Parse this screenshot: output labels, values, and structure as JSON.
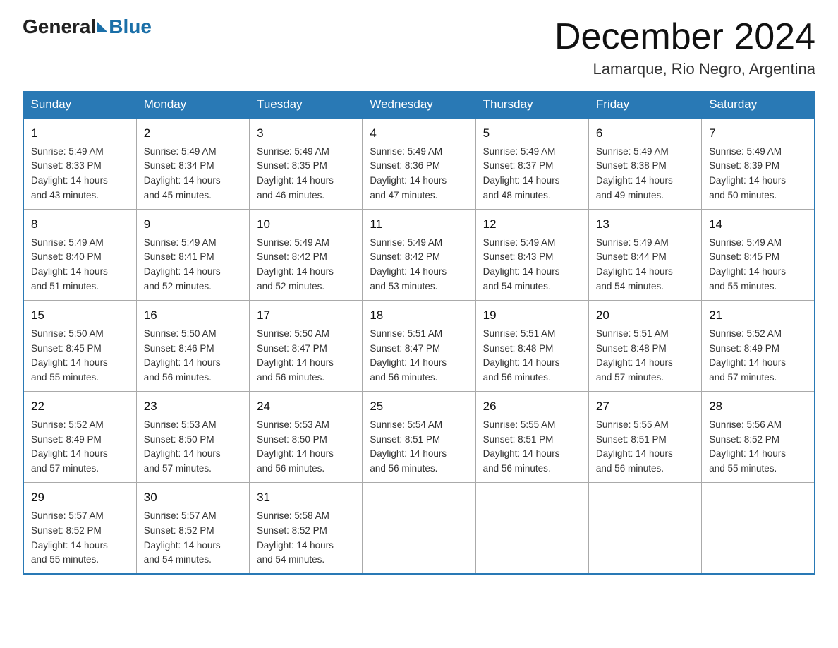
{
  "logo": {
    "general": "General",
    "blue": "Blue"
  },
  "header": {
    "month_title": "December 2024",
    "location": "Lamarque, Rio Negro, Argentina"
  },
  "days_of_week": [
    "Sunday",
    "Monday",
    "Tuesday",
    "Wednesday",
    "Thursday",
    "Friday",
    "Saturday"
  ],
  "weeks": [
    [
      {
        "num": "1",
        "sunrise": "5:49 AM",
        "sunset": "8:33 PM",
        "daylight": "14 hours and 43 minutes."
      },
      {
        "num": "2",
        "sunrise": "5:49 AM",
        "sunset": "8:34 PM",
        "daylight": "14 hours and 45 minutes."
      },
      {
        "num": "3",
        "sunrise": "5:49 AM",
        "sunset": "8:35 PM",
        "daylight": "14 hours and 46 minutes."
      },
      {
        "num": "4",
        "sunrise": "5:49 AM",
        "sunset": "8:36 PM",
        "daylight": "14 hours and 47 minutes."
      },
      {
        "num": "5",
        "sunrise": "5:49 AM",
        "sunset": "8:37 PM",
        "daylight": "14 hours and 48 minutes."
      },
      {
        "num": "6",
        "sunrise": "5:49 AM",
        "sunset": "8:38 PM",
        "daylight": "14 hours and 49 minutes."
      },
      {
        "num": "7",
        "sunrise": "5:49 AM",
        "sunset": "8:39 PM",
        "daylight": "14 hours and 50 minutes."
      }
    ],
    [
      {
        "num": "8",
        "sunrise": "5:49 AM",
        "sunset": "8:40 PM",
        "daylight": "14 hours and 51 minutes."
      },
      {
        "num": "9",
        "sunrise": "5:49 AM",
        "sunset": "8:41 PM",
        "daylight": "14 hours and 52 minutes."
      },
      {
        "num": "10",
        "sunrise": "5:49 AM",
        "sunset": "8:42 PM",
        "daylight": "14 hours and 52 minutes."
      },
      {
        "num": "11",
        "sunrise": "5:49 AM",
        "sunset": "8:42 PM",
        "daylight": "14 hours and 53 minutes."
      },
      {
        "num": "12",
        "sunrise": "5:49 AM",
        "sunset": "8:43 PM",
        "daylight": "14 hours and 54 minutes."
      },
      {
        "num": "13",
        "sunrise": "5:49 AM",
        "sunset": "8:44 PM",
        "daylight": "14 hours and 54 minutes."
      },
      {
        "num": "14",
        "sunrise": "5:49 AM",
        "sunset": "8:45 PM",
        "daylight": "14 hours and 55 minutes."
      }
    ],
    [
      {
        "num": "15",
        "sunrise": "5:50 AM",
        "sunset": "8:45 PM",
        "daylight": "14 hours and 55 minutes."
      },
      {
        "num": "16",
        "sunrise": "5:50 AM",
        "sunset": "8:46 PM",
        "daylight": "14 hours and 56 minutes."
      },
      {
        "num": "17",
        "sunrise": "5:50 AM",
        "sunset": "8:47 PM",
        "daylight": "14 hours and 56 minutes."
      },
      {
        "num": "18",
        "sunrise": "5:51 AM",
        "sunset": "8:47 PM",
        "daylight": "14 hours and 56 minutes."
      },
      {
        "num": "19",
        "sunrise": "5:51 AM",
        "sunset": "8:48 PM",
        "daylight": "14 hours and 56 minutes."
      },
      {
        "num": "20",
        "sunrise": "5:51 AM",
        "sunset": "8:48 PM",
        "daylight": "14 hours and 57 minutes."
      },
      {
        "num": "21",
        "sunrise": "5:52 AM",
        "sunset": "8:49 PM",
        "daylight": "14 hours and 57 minutes."
      }
    ],
    [
      {
        "num": "22",
        "sunrise": "5:52 AM",
        "sunset": "8:49 PM",
        "daylight": "14 hours and 57 minutes."
      },
      {
        "num": "23",
        "sunrise": "5:53 AM",
        "sunset": "8:50 PM",
        "daylight": "14 hours and 57 minutes."
      },
      {
        "num": "24",
        "sunrise": "5:53 AM",
        "sunset": "8:50 PM",
        "daylight": "14 hours and 56 minutes."
      },
      {
        "num": "25",
        "sunrise": "5:54 AM",
        "sunset": "8:51 PM",
        "daylight": "14 hours and 56 minutes."
      },
      {
        "num": "26",
        "sunrise": "5:55 AM",
        "sunset": "8:51 PM",
        "daylight": "14 hours and 56 minutes."
      },
      {
        "num": "27",
        "sunrise": "5:55 AM",
        "sunset": "8:51 PM",
        "daylight": "14 hours and 56 minutes."
      },
      {
        "num": "28",
        "sunrise": "5:56 AM",
        "sunset": "8:52 PM",
        "daylight": "14 hours and 55 minutes."
      }
    ],
    [
      {
        "num": "29",
        "sunrise": "5:57 AM",
        "sunset": "8:52 PM",
        "daylight": "14 hours and 55 minutes."
      },
      {
        "num": "30",
        "sunrise": "5:57 AM",
        "sunset": "8:52 PM",
        "daylight": "14 hours and 54 minutes."
      },
      {
        "num": "31",
        "sunrise": "5:58 AM",
        "sunset": "8:52 PM",
        "daylight": "14 hours and 54 minutes."
      },
      null,
      null,
      null,
      null
    ]
  ],
  "labels": {
    "sunrise": "Sunrise:",
    "sunset": "Sunset:",
    "daylight": "Daylight:"
  }
}
